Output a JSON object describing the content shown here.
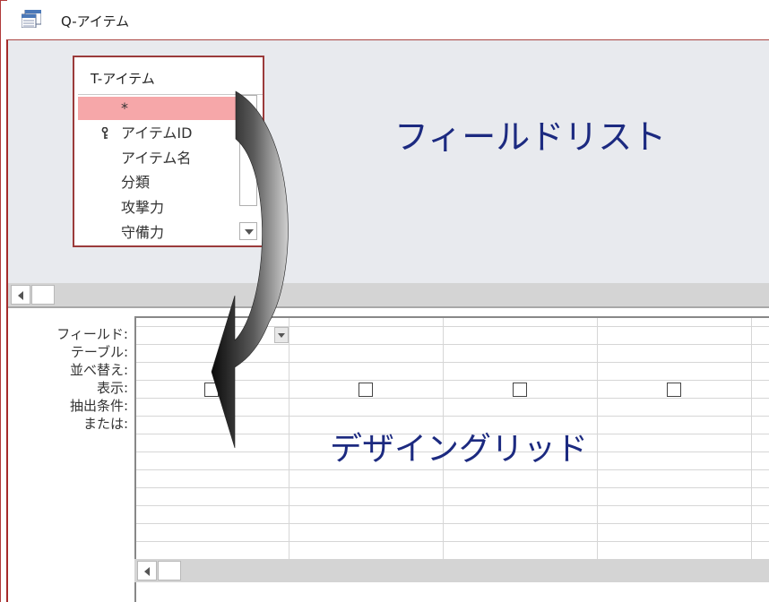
{
  "window": {
    "title": "Q-アイテム"
  },
  "field_list": {
    "table_name": "T-アイテム",
    "fields": [
      "*",
      "アイテムID",
      "アイテム名",
      "分類",
      "攻撃力",
      "守備力"
    ],
    "selected_field": "*",
    "primary_key_field": "アイテムID"
  },
  "design_grid": {
    "row_labels": [
      "フィールド:",
      "テーブル:",
      "並べ替え:",
      "表示:",
      "抽出条件:",
      "または:"
    ],
    "show_checkboxes": [
      false,
      false,
      false,
      false
    ]
  },
  "annotations": {
    "field_list_label": "フィールドリスト",
    "design_grid_label": "デザイングリッド"
  },
  "colors": {
    "frame_border": "#a94442",
    "selected_field_bg": "#f6a7a9",
    "annotation_text": "#1c2a80",
    "upper_pane_bg": "#e8eaee"
  },
  "icons": {
    "query": "query-icon",
    "primary_key": "key-icon",
    "scroll_down": "chevron-down-icon",
    "scroll_left": "chevron-left-icon"
  }
}
